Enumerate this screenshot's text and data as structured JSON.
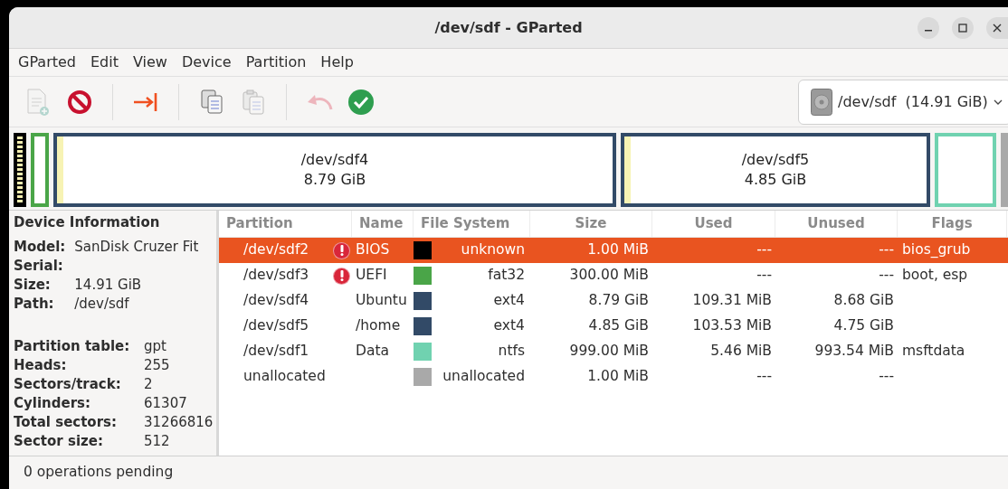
{
  "window": {
    "title": "/dev/sdf - GParted"
  },
  "menu": [
    "GParted",
    "Edit",
    "View",
    "Device",
    "Partition",
    "Help"
  ],
  "toolbar": [
    {
      "kind": "new",
      "disabled": true
    },
    {
      "kind": "delete",
      "disabled": false
    },
    {
      "kind": "sep"
    },
    {
      "kind": "resize",
      "disabled": false
    },
    {
      "kind": "sep"
    },
    {
      "kind": "copy",
      "disabled": false
    },
    {
      "kind": "paste",
      "disabled": true
    },
    {
      "kind": "sep"
    },
    {
      "kind": "undo",
      "disabled": true
    },
    {
      "kind": "apply",
      "disabled": false
    }
  ],
  "device_selector": {
    "value": "/dev/sdf  (14.91 GiB)"
  },
  "partition_map": [
    {
      "kind": "small",
      "color": "#000000"
    },
    {
      "kind": "small",
      "color": "#4aa548"
    },
    {
      "kind": "part",
      "color": "#324a67",
      "name": "/dev/sdf4",
      "size": "8.79 GiB",
      "level": 0.012
    },
    {
      "kind": "part",
      "color": "#324a67",
      "name": "/dev/sdf5",
      "size": "4.85 GiB",
      "level": 0.021
    },
    {
      "kind": "small",
      "color": "#70d2b0"
    },
    {
      "kind": "free",
      "color": "#a9a9a9"
    }
  ],
  "device_info": {
    "title": "Device Information",
    "groups": [
      [
        {
          "label": "Model:",
          "value": "SanDisk Cruzer Fit"
        },
        {
          "label": "Serial:"
        },
        {
          "label": "Size:",
          "value": "14.91 GiB"
        },
        {
          "label": "Path:",
          "value": "/dev/sdf"
        }
      ],
      [
        {
          "label": "Partition table:",
          "value": "gpt"
        },
        {
          "label": "Heads:",
          "value": "255"
        },
        {
          "label": "Sectors/track:",
          "value": "2"
        },
        {
          "label": "Cylinders:",
          "value": "61307"
        },
        {
          "label": "Total sectors:",
          "value": "31266816"
        },
        {
          "label": "Sector size:",
          "value": "512"
        }
      ]
    ]
  },
  "table": {
    "columns": [
      "Partition",
      "Name",
      "File System",
      "Size",
      "Used",
      "Unused",
      "Flags"
    ],
    "rows": [
      {
        "partition": "/dev/sdf2",
        "warning": true,
        "name": "BIOS",
        "color": "#000000",
        "file_system": "unknown",
        "size": "1.00 MiB",
        "used": "---",
        "unused": "---",
        "flags": "bios_grub",
        "selected": true
      },
      {
        "partition": "/dev/sdf3",
        "warning": true,
        "name": "UEFI",
        "color": "#4aa548",
        "file_system": "fat32",
        "size": "300.00 MiB",
        "used": "---",
        "unused": "---",
        "flags": "boot, esp",
        "selected": false
      },
      {
        "partition": "/dev/sdf4",
        "warning": false,
        "name": "Ubuntu",
        "color": "#324a67",
        "file_system": "ext4",
        "size": "8.79 GiB",
        "used": "109.31 MiB",
        "unused": "8.68 GiB",
        "selected": false
      },
      {
        "partition": "/dev/sdf5",
        "warning": false,
        "name": "/home",
        "color": "#324a67",
        "file_system": "ext4",
        "size": "4.85 GiB",
        "used": "103.53 MiB",
        "unused": "4.75 GiB",
        "selected": false
      },
      {
        "partition": "/dev/sdf1",
        "warning": false,
        "name": "Data",
        "color": "#70d2b0",
        "file_system": "ntfs",
        "size": "999.00 MiB",
        "used": "5.46 MiB",
        "unused": "993.54 MiB",
        "flags": "msftdata",
        "selected": false
      },
      {
        "partition": "unallocated",
        "warning": false,
        "color": "#a9a9a9",
        "file_system": "unallocated",
        "size": "1.00 MiB",
        "used": "---",
        "unused": "---",
        "selected": false
      }
    ]
  },
  "status_bar": "0 operations pending"
}
